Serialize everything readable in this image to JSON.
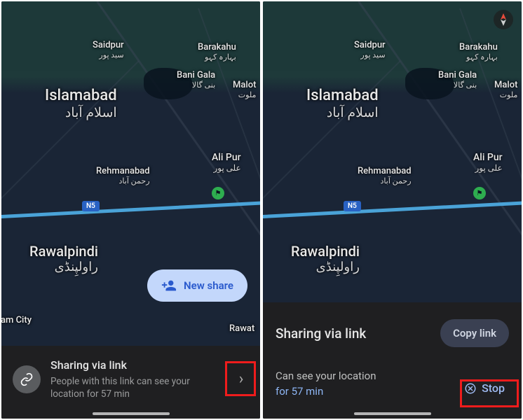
{
  "map": {
    "highway_badge": "N5",
    "labels": {
      "saidpur": {
        "main": "Saidpur",
        "sub": "سید پور"
      },
      "barakahu": {
        "main": "Barakahu",
        "sub": "بہارہ کہو"
      },
      "banigala": {
        "main": "Bani Gala",
        "sub": "بنی گالا"
      },
      "malot": {
        "main": "Malot",
        "sub": "ملوت"
      },
      "islamabad": {
        "main": "Islamabad",
        "sub": "اسلام آباد"
      },
      "alipur": {
        "main": "Ali Pur",
        "sub": "علی پور"
      },
      "rehmanabad": {
        "main": "Rehmanabad",
        "sub": "رحمن آباد"
      },
      "rawalpindi": {
        "main": "Rawalpindi",
        "sub": "راولپِنڈی"
      },
      "amcity": {
        "main": "am City"
      },
      "rawat": {
        "main": "Rawat"
      }
    }
  },
  "screen1": {
    "new_share_label": "New share",
    "sheet": {
      "title": "Sharing via link",
      "subtitle": "People with this link can see your location for 57 min"
    }
  },
  "screen2": {
    "sheet": {
      "title": "Sharing via link",
      "copy_label": "Copy link",
      "line1": "Can see your location",
      "line2": "for 57 min",
      "stop_label": "Stop"
    }
  }
}
